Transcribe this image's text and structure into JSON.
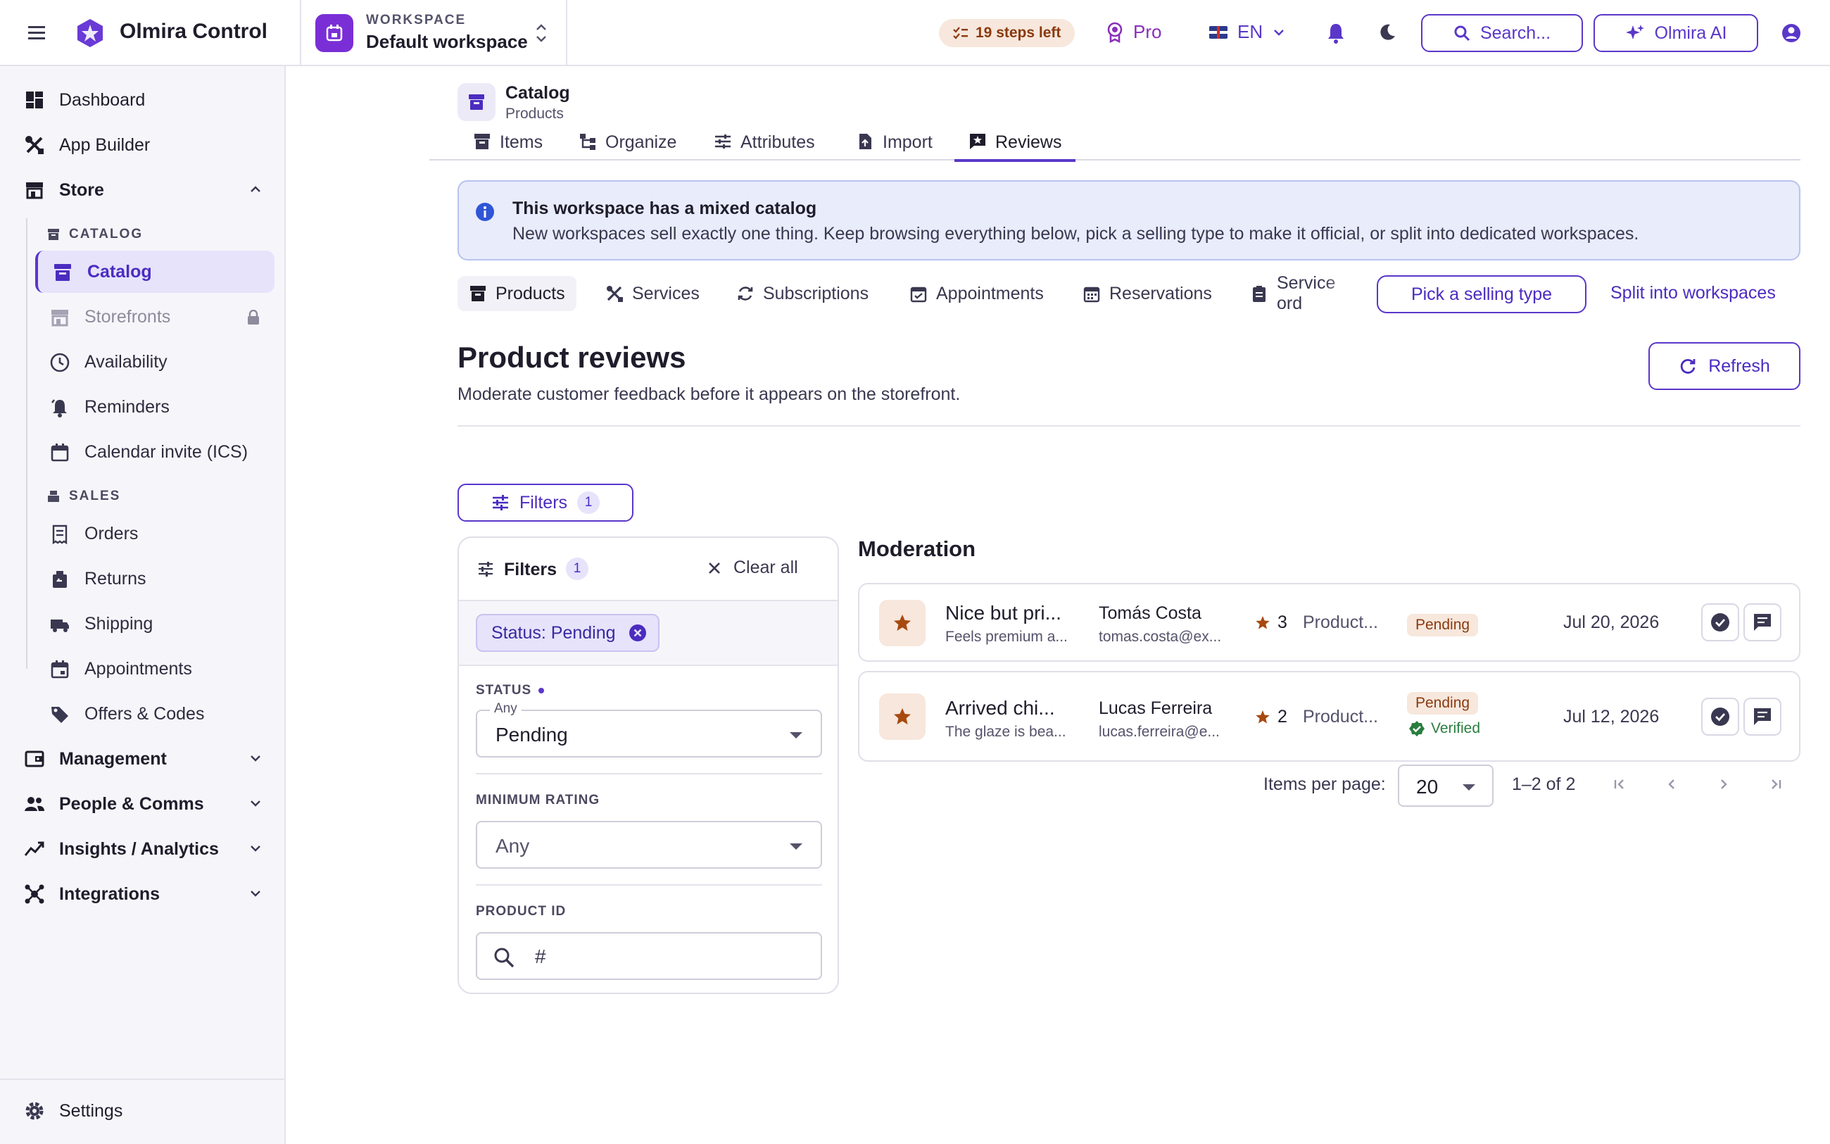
{
  "app": {
    "name": "Olmira Control"
  },
  "workspace": {
    "caption": "WORKSPACE",
    "name": "Default workspace"
  },
  "topbar": {
    "steps_left": "19 steps left",
    "plan": "Pro",
    "language": "EN",
    "search_label": "Search...",
    "ai_label": "Olmira AI"
  },
  "sidebar": {
    "dashboard": "Dashboard",
    "app_builder": "App Builder",
    "store": "Store",
    "catalog_section": "CATALOG",
    "catalog_items": [
      "Catalog",
      "Storefronts",
      "Availability",
      "Reminders",
      "Calendar invite (ICS)"
    ],
    "sales_section": "SALES",
    "sales_items": [
      "Orders",
      "Returns",
      "Shipping",
      "Appointments",
      "Offers & Codes"
    ],
    "management": "Management",
    "people": "People & Comms",
    "insights": "Insights / Analytics",
    "integrations": "Integrations",
    "settings": "Settings"
  },
  "breadcrumb": {
    "title": "Catalog",
    "subtitle": "Products"
  },
  "tabs": [
    "Items",
    "Organize",
    "Attributes",
    "Import",
    "Reviews"
  ],
  "banner": {
    "title": "This workspace has a mixed catalog",
    "text": "New workspaces sell exactly one thing. Keep browsing everything below, pick a selling type to make it official, or split into dedicated workspaces."
  },
  "selling_types": [
    "Products",
    "Services",
    "Subscriptions",
    "Appointments",
    "Reservations",
    "Service ord"
  ],
  "selling_actions": {
    "pick": "Pick a selling type",
    "split": "Split into workspaces"
  },
  "page": {
    "title": "Product reviews",
    "subtitle": "Moderate customer feedback before it appears on the storefront.",
    "refresh": "Refresh"
  },
  "filters": {
    "toggle_label": "Filters",
    "count": "1",
    "panel_title": "Filters",
    "clear_all": "Clear all",
    "chip": "Status: Pending",
    "status_label": "STATUS",
    "status_legend": "Any",
    "status_value": "Pending",
    "min_rating_label": "MINIMUM RATING",
    "min_rating_value": "Any",
    "product_id_label": "PRODUCT ID",
    "product_id_placeholder": "#"
  },
  "moderation": {
    "title": "Moderation",
    "reviews": [
      {
        "title": "Nice but pri...",
        "body": "Feels premium a...",
        "name": "Tomás Costa",
        "email": "tomas.costa@ex...",
        "rating": "3",
        "product": "Product...",
        "status": "Pending",
        "verified": "",
        "date": "Jul 20, 2026"
      },
      {
        "title": "Arrived chi...",
        "body": "The glaze is bea...",
        "name": "Lucas Ferreira",
        "email": "lucas.ferreira@e...",
        "rating": "2",
        "product": "Product...",
        "status": "Pending",
        "verified": "Verified",
        "date": "Jul 12, 2026"
      }
    ]
  },
  "pagination": {
    "items_per_page_label": "Items per page:",
    "items_per_page": "20",
    "range": "1–2 of 2"
  },
  "colors": {
    "accent": "#5a37c9",
    "pending_bg": "#f7e7dc",
    "pending_text": "#8a3a10",
    "verified": "#2a7d3f",
    "star": "#a8490f"
  }
}
